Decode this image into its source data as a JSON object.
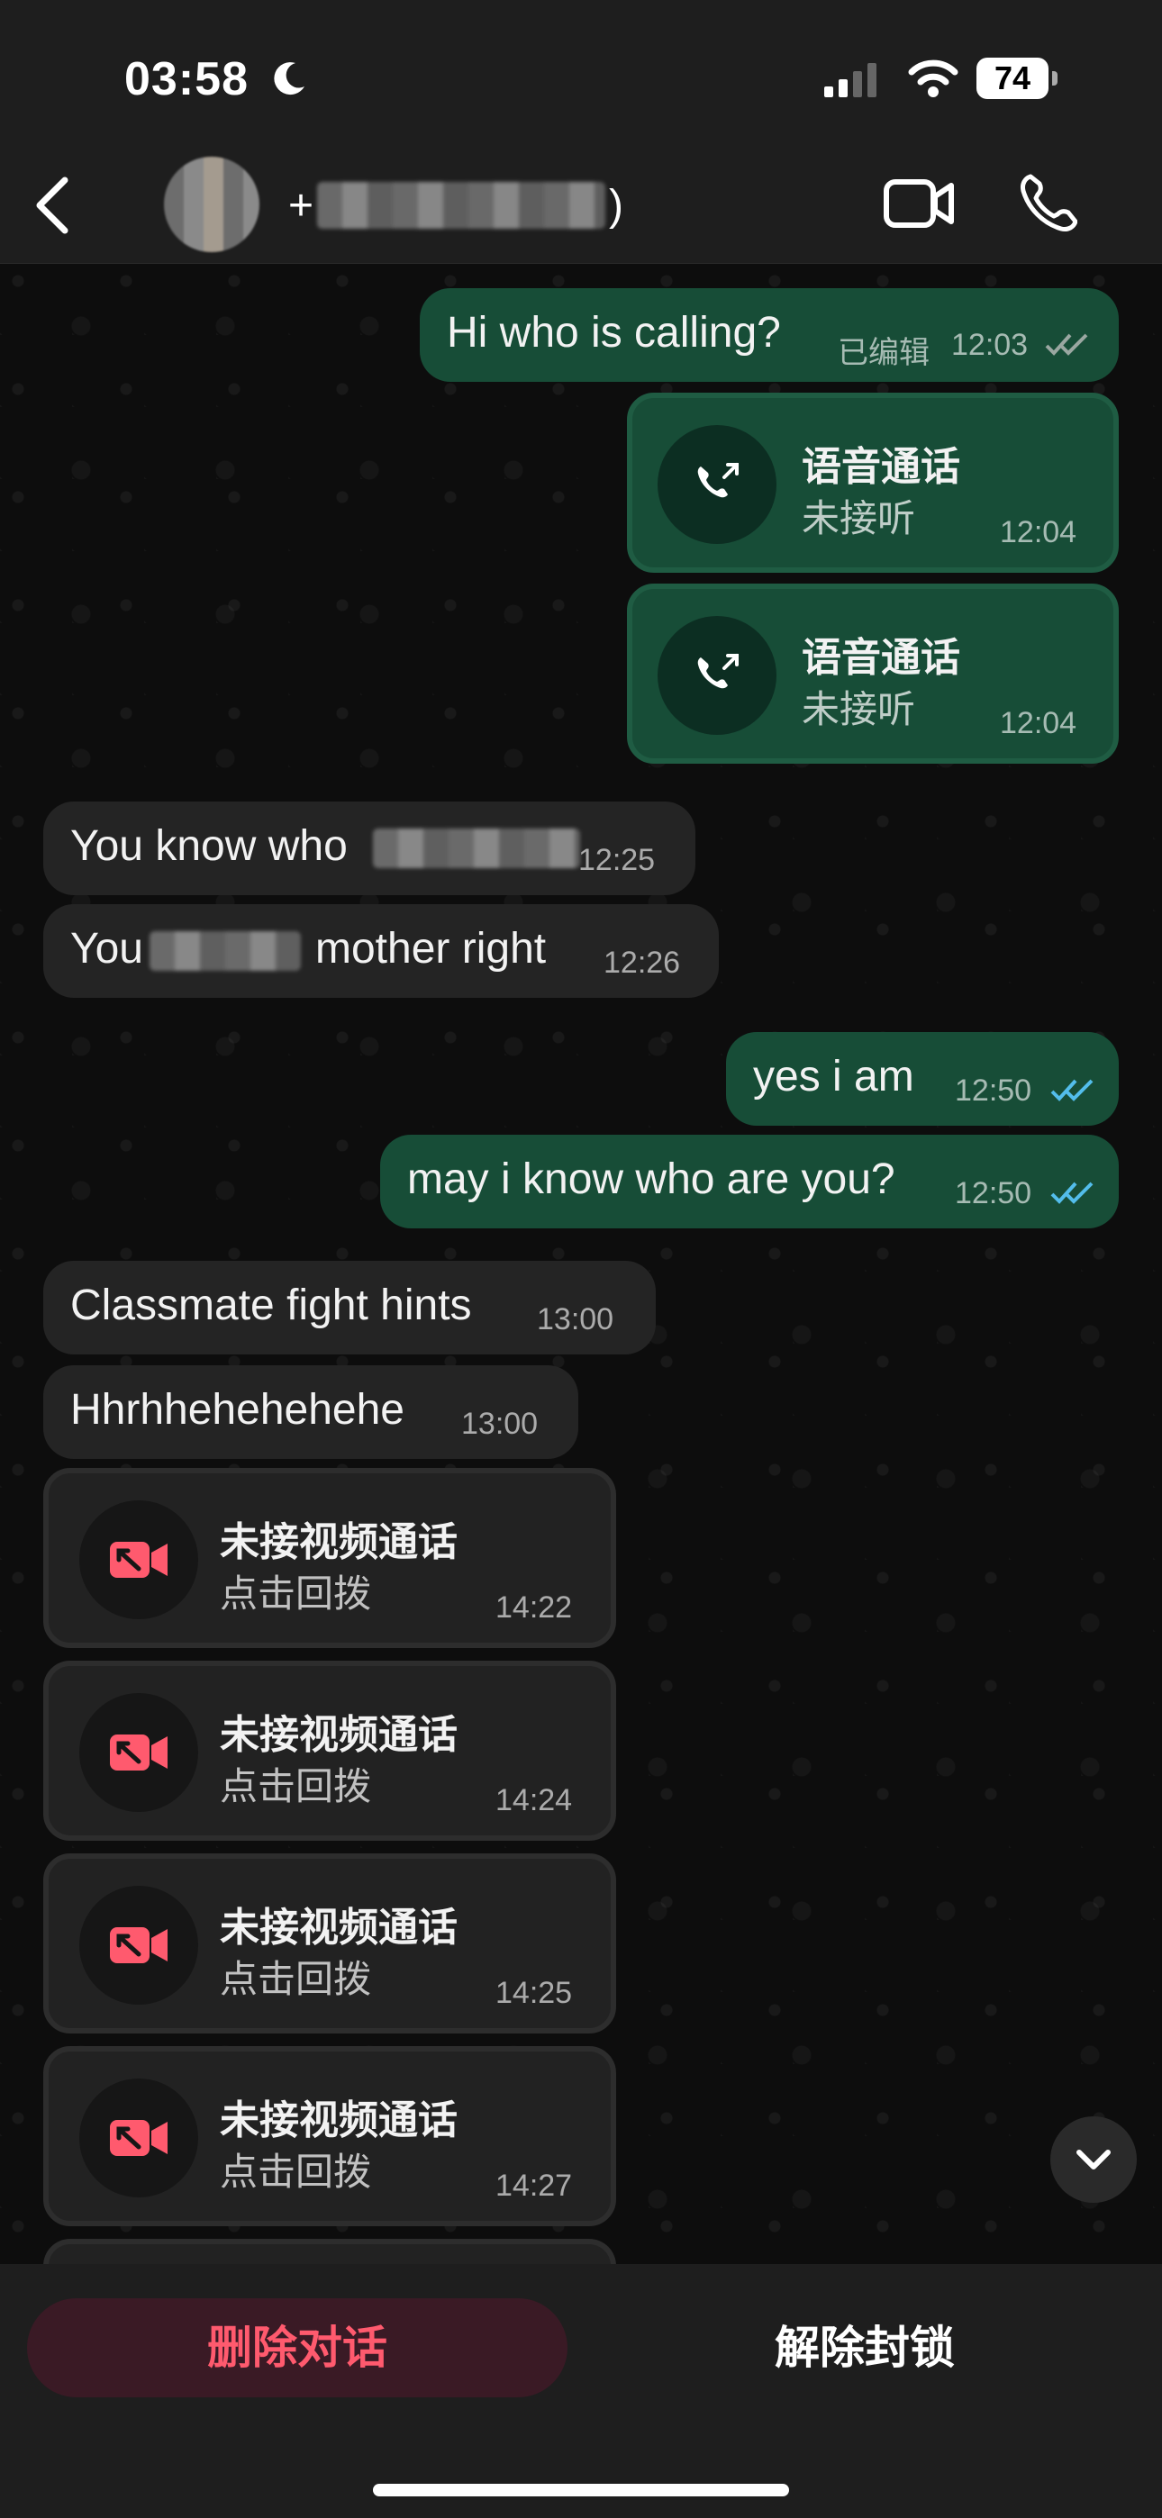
{
  "status_bar": {
    "time": "03:58",
    "battery": "74"
  },
  "header": {
    "contact_prefix": "+",
    "contact_suffix": ")"
  },
  "messages": [
    {
      "text": "Hi who is calling?",
      "edited": "已编辑",
      "time": "12:03"
    },
    {
      "title": "语音通话",
      "subtitle": "未接听",
      "time": "12:04"
    },
    {
      "title": "语音通话",
      "subtitle": "未接听",
      "time": "12:04"
    },
    {
      "text": "You know who",
      "time": "12:25"
    },
    {
      "text_start": "You",
      "text_end": "mother right",
      "time": "12:26"
    },
    {
      "text": "yes i am",
      "time": "12:50"
    },
    {
      "text": "may i know who are you?",
      "time": "12:50"
    },
    {
      "text": "Classmate fight hints",
      "time": "13:00"
    },
    {
      "text": "Hhrhhehehehehe",
      "time": "13:00"
    },
    {
      "title": "未接视频通话",
      "subtitle": "点击回拨",
      "time": "14:22"
    },
    {
      "title": "未接视频通话",
      "subtitle": "点击回拨",
      "time": "14:24"
    },
    {
      "title": "未接视频通话",
      "subtitle": "点击回拨",
      "time": "14:25"
    },
    {
      "title": "未接视频通话",
      "subtitle": "点击回拨",
      "time": "14:27"
    }
  ],
  "bottom": {
    "delete_label": "删除对话",
    "unblock_label": "解除封锁"
  },
  "colors": {
    "outgoing": "#174d37",
    "incoming": "#242424",
    "read_ticks": "#53bdeb",
    "missed_red": "#ff5a6e"
  },
  "icons": [
    "moon-icon",
    "signal-icon",
    "wifi-icon",
    "back-icon",
    "video-call-icon",
    "phone-icon",
    "outgoing-call-icon",
    "missed-video-call-icon",
    "chevron-down-icon"
  ]
}
